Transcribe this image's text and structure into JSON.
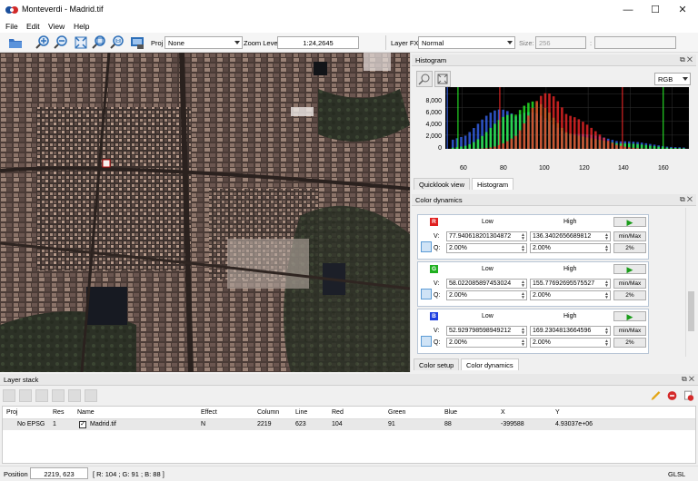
{
  "window": {
    "title": "Monteverdi - Madrid.tif",
    "min": "—",
    "max": "☐",
    "close": "✕"
  },
  "menu": [
    "File",
    "Edit",
    "View",
    "Help"
  ],
  "toolbar": {
    "proj_label": "Proj",
    "proj_value": "None",
    "zoom_label": "Zoom Level",
    "zoom_value": "1:24,2645",
    "layerfx_label": "Layer FX",
    "layerfx_value": "Normal",
    "size_label": "Size:",
    "size_value": "256",
    "colon": ":"
  },
  "histogram": {
    "title": "Histogram",
    "mode": "RGB",
    "yticks": [
      "8,000",
      "6,000",
      "4,000",
      "2,000",
      "0"
    ],
    "xticks": [
      "60",
      "80",
      "100",
      "120",
      "140",
      "160"
    ],
    "tabs": [
      "Quicklook view",
      "Histogram"
    ],
    "colors": {
      "red": "#ff2a2a",
      "green": "#2aff2a",
      "blue": "#3a6bff"
    }
  },
  "color_dynamics": {
    "title": "Color dynamics",
    "channels": [
      {
        "badge": "R",
        "color": "#e02020",
        "low_label": "Low",
        "high_label": "High",
        "v_label": "V:",
        "q_label": "Q:",
        "low_v": "77.940618201304872",
        "high_v": "136.3402656689812",
        "low_q": "2.00%",
        "high_q": "2.00%",
        "minmax": "min/Max",
        "pct": "2%"
      },
      {
        "badge": "G",
        "color": "#20b020",
        "low_label": "Low",
        "high_label": "High",
        "v_label": "V:",
        "q_label": "Q:",
        "low_v": "58.022085897453024",
        "high_v": "155.77692695575527",
        "low_q": "2.00%",
        "high_q": "2.00%",
        "minmax": "min/Max",
        "pct": "2%"
      },
      {
        "badge": "B",
        "color": "#2040e0",
        "low_label": "Low",
        "high_label": "High",
        "v_label": "V:",
        "q_label": "Q:",
        "low_v": "52.929798598949212",
        "high_v": "169.2304813664596",
        "low_q": "2.00%",
        "high_q": "2.00%",
        "minmax": "min/Max",
        "pct": "2%"
      }
    ],
    "tabs": [
      "Color setup",
      "Color dynamics"
    ]
  },
  "layer_stack": {
    "title": "Layer stack",
    "columns": [
      "Proj",
      "Res",
      "Name",
      "Effect",
      "Column",
      "Line",
      "Red",
      "Green",
      "Blue",
      "X",
      "Y"
    ],
    "rows": [
      {
        "proj": "No EPSG",
        "res": "1",
        "name": "Madrid.tif",
        "effect": "N",
        "column": "2219",
        "line": "623",
        "red": "104",
        "green": "91",
        "blue": "88",
        "x": "-399588",
        "y": "4.93037e+06"
      }
    ]
  },
  "status": {
    "position_label": "Position",
    "position_value": "2219, 623",
    "rgb": "[ R: 104 ; G: 91 ; B: 88 ]",
    "renderer": "GLSL"
  }
}
